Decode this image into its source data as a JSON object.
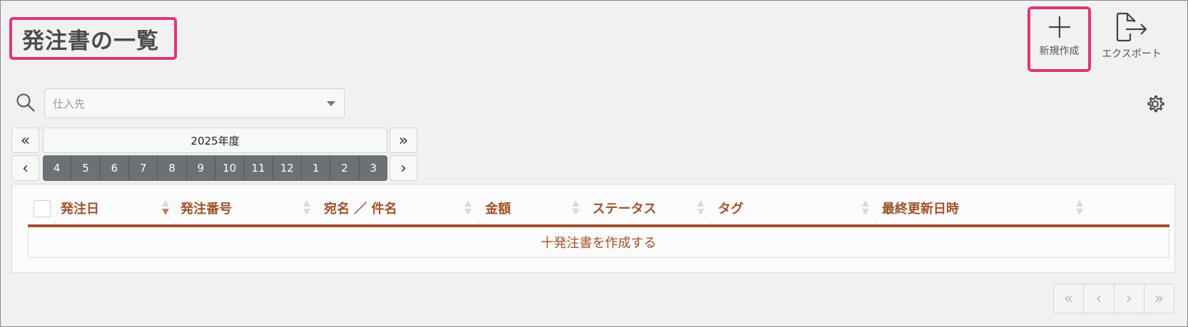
{
  "page": {
    "title": "発注書の一覧"
  },
  "toolbar": {
    "new_label": "新規作成",
    "export_label": "エクスポート",
    "new_icon": "plus-icon",
    "export_icon": "export-icon"
  },
  "filter": {
    "supplier_placeholder": "仕入先",
    "search_icon": "search-icon",
    "settings_icon": "gear-icon"
  },
  "period": {
    "prev_year": "«",
    "next_year": "»",
    "prev_month": "‹",
    "next_month": "›",
    "year_label": "2025年度",
    "months": [
      "4",
      "5",
      "6",
      "7",
      "8",
      "9",
      "10",
      "11",
      "12",
      "1",
      "2",
      "3"
    ]
  },
  "table": {
    "columns": [
      "発注日",
      "発注番号",
      "宛名 ／ 件名",
      "金額",
      "ステータス",
      "タグ",
      "最終更新日時"
    ],
    "sorted_column": "発注日",
    "sort_direction": "desc",
    "empty_action": "十発注書を作成する"
  },
  "pagination": {
    "first": "«",
    "prev": "‹",
    "next": "›",
    "last": "»"
  },
  "colors": {
    "accent": "#a0522d",
    "highlight": "#e0357d",
    "month_bg": "#6c7175"
  }
}
